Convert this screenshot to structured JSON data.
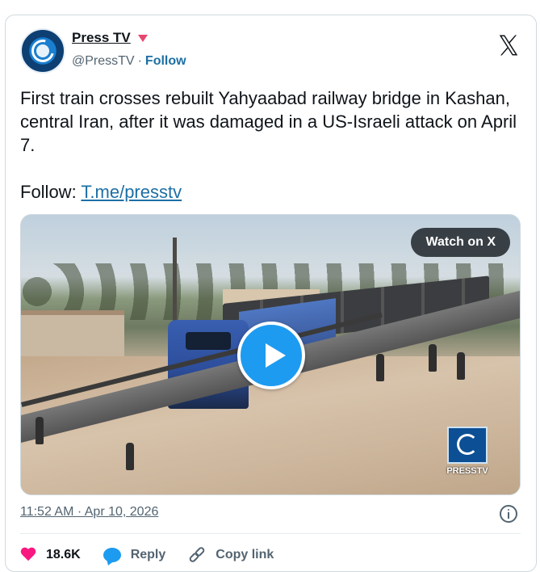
{
  "author": {
    "name": "Press TV",
    "handle": "@PressTV",
    "separator": "·",
    "follow_label": "Follow"
  },
  "tweet": {
    "text": "First train crosses rebuilt Yahyaabad railway bridge in Kashan, central Iran, after it was damaged in a US-Israeli attack on April 7.",
    "follow_prefix": "Follow: ",
    "link_text": "T.me/presstv"
  },
  "media": {
    "watch_label": "Watch on X",
    "watermark_text": "PRESSTV"
  },
  "meta": {
    "timestamp": "11:52 AM · Apr 10, 2026"
  },
  "actions": {
    "likes": "18.6K",
    "reply_label": "Reply",
    "copy_link_label": "Copy link"
  },
  "colors": {
    "accent": "#1d9bf0",
    "link": "#1d6fa5",
    "like": "#f91880",
    "muted": "#536471"
  },
  "icons": {
    "platform": "x-logo-icon",
    "like": "heart-icon",
    "reply": "reply-bubble-icon",
    "copy": "link-icon",
    "info": "info-icon",
    "play": "play-icon"
  }
}
